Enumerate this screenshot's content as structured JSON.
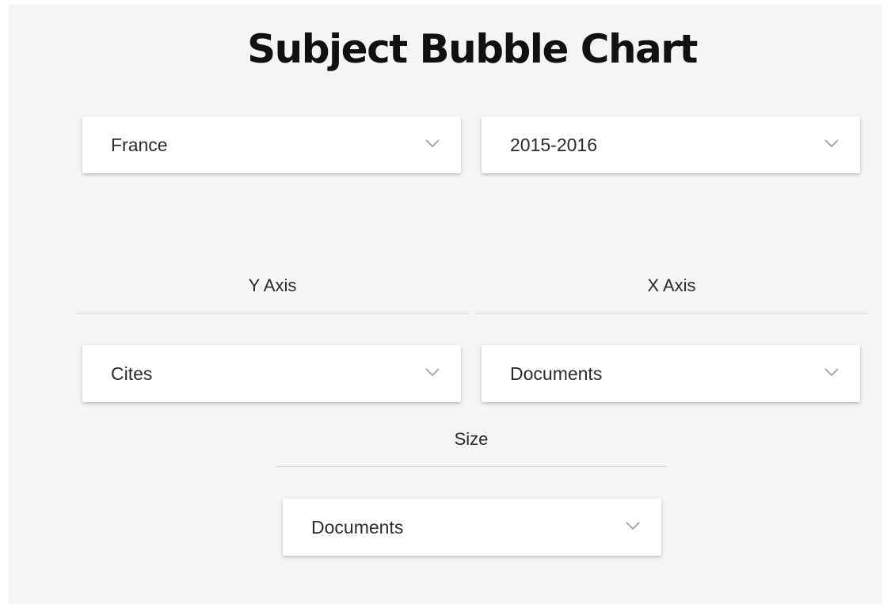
{
  "page": {
    "title": "Subject Bubble Chart"
  },
  "filters": {
    "country": {
      "value": "France"
    },
    "period": {
      "value": "2015-2016"
    }
  },
  "axes": {
    "y": {
      "label": "Y Axis",
      "value": "Cites"
    },
    "x": {
      "label": "X Axis",
      "value": "Documents"
    },
    "size": {
      "label": "Size",
      "value": "Documents"
    }
  },
  "icons": {
    "dropdown": "chevron-down-icon"
  }
}
